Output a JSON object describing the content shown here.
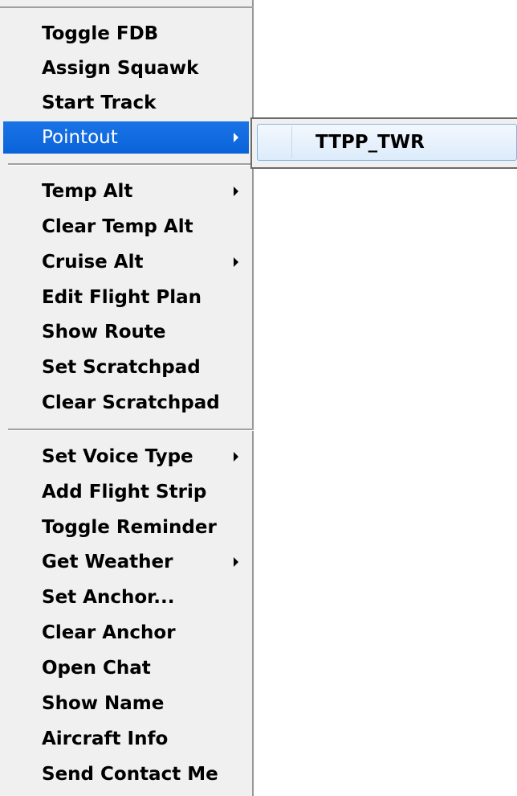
{
  "context_menu": {
    "groups": [
      {
        "items": [
          {
            "label": "Toggle FDB",
            "has_submenu": false
          },
          {
            "label": "Assign Squawk",
            "has_submenu": false
          },
          {
            "label": "Start Track",
            "has_submenu": false
          },
          {
            "label": "Pointout",
            "has_submenu": true,
            "highlighted": true
          }
        ]
      },
      {
        "items": [
          {
            "label": "Temp Alt",
            "has_submenu": true
          },
          {
            "label": "Clear Temp Alt",
            "has_submenu": false
          },
          {
            "label": "Cruise Alt",
            "has_submenu": true
          },
          {
            "label": "Edit Flight Plan",
            "has_submenu": false
          },
          {
            "label": "Show Route",
            "has_submenu": false
          },
          {
            "label": "Set Scratchpad",
            "has_submenu": false
          },
          {
            "label": "Clear Scratchpad",
            "has_submenu": false
          }
        ]
      },
      {
        "items": [
          {
            "label": "Set Voice Type",
            "has_submenu": true
          },
          {
            "label": "Add Flight Strip",
            "has_submenu": false
          },
          {
            "label": "Toggle Reminder",
            "has_submenu": false
          },
          {
            "label": "Get Weather",
            "has_submenu": true
          },
          {
            "label": "Set Anchor...",
            "has_submenu": false
          },
          {
            "label": "Clear Anchor",
            "has_submenu": false
          },
          {
            "label": "Open Chat",
            "has_submenu": false
          },
          {
            "label": "Show Name",
            "has_submenu": false
          },
          {
            "label": "Aircraft Info",
            "has_submenu": false
          },
          {
            "label": "Send Contact Me",
            "has_submenu": false
          }
        ]
      }
    ]
  },
  "pointout_submenu": {
    "items": [
      {
        "label": "TTPP_TWR",
        "hovered": true
      }
    ]
  },
  "colors": {
    "menu_background": "#f0f0f0",
    "highlight": "#0a62d8",
    "highlight_text": "#ffffff",
    "submenu_hover": "#dcebfb"
  }
}
